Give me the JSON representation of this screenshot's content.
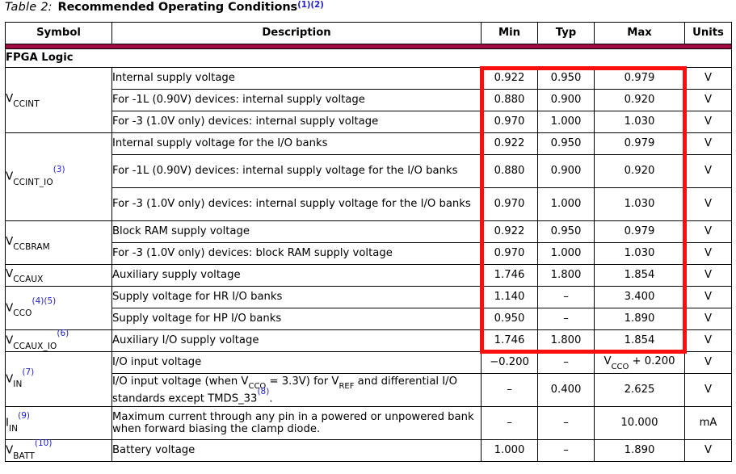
{
  "caption": {
    "label": "Table",
    "number": "2:",
    "title": "Recommended Operating Conditions",
    "footnotes": "(1)(2)"
  },
  "colors": {
    "header_rule": "#9e0b40",
    "footnote_blue": "#2222cc",
    "highlight_red": "#fb0f0f",
    "border": "#000000"
  },
  "table": {
    "columns": [
      "Symbol",
      "Description",
      "Min",
      "Typ",
      "Max",
      "Units"
    ],
    "section": "FPGA Logic",
    "rows": [
      {
        "symbol_main": "V",
        "symbol_sub": "CCINT",
        "symbol_fn": "",
        "description": "Internal supply voltage",
        "min": "0.922",
        "typ": "0.950",
        "max": "0.979",
        "units": "V",
        "lines": 1
      },
      {
        "symbol_main": "",
        "symbol_sub": "",
        "symbol_fn": "",
        "description": "For -1L (0.90V) devices: internal supply voltage",
        "min": "0.880",
        "typ": "0.900",
        "max": "0.920",
        "units": "V",
        "lines": 1
      },
      {
        "symbol_main": "",
        "symbol_sub": "",
        "symbol_fn": "",
        "description": "For -3 (1.0V only) devices: internal supply voltage",
        "min": "0.970",
        "typ": "1.000",
        "max": "1.030",
        "units": "V",
        "lines": 1
      },
      {
        "symbol_main": "V",
        "symbol_sub": "CCINT_IO",
        "symbol_fn": "(3)",
        "description": "Internal supply voltage for the I/O banks",
        "min": "0.922",
        "typ": "0.950",
        "max": "0.979",
        "units": "V",
        "lines": 1
      },
      {
        "symbol_main": "",
        "symbol_sub": "",
        "symbol_fn": "",
        "description": "For -1L (0.90V) devices: internal supply voltage for the I/O banks",
        "min": "0.880",
        "typ": "0.900",
        "max": "0.920",
        "units": "V",
        "lines": 2
      },
      {
        "symbol_main": "",
        "symbol_sub": "",
        "symbol_fn": "",
        "description": "For -3 (1.0V only) devices: internal supply voltage for the I/O banks",
        "min": "0.970",
        "typ": "1.000",
        "max": "1.030",
        "units": "V",
        "lines": 2
      },
      {
        "symbol_main": "V",
        "symbol_sub": "CCBRAM",
        "symbol_fn": "",
        "description": "Block RAM supply voltage",
        "min": "0.922",
        "typ": "0.950",
        "max": "0.979",
        "units": "V",
        "lines": 1
      },
      {
        "symbol_main": "",
        "symbol_sub": "",
        "symbol_fn": "",
        "description": "For -3 (1.0V only) devices: block RAM supply voltage",
        "min": "0.970",
        "typ": "1.000",
        "max": "1.030",
        "units": "V",
        "lines": 1
      },
      {
        "symbol_main": "V",
        "symbol_sub": "CCAUX",
        "symbol_fn": "",
        "description": "Auxiliary supply voltage",
        "min": "1.746",
        "typ": "1.800",
        "max": "1.854",
        "units": "V",
        "lines": 1
      },
      {
        "symbol_main": "V",
        "symbol_sub": "CCO",
        "symbol_fn": "(4)(5)",
        "description": "Supply voltage for HR I/O banks",
        "min": "1.140",
        "typ": "–",
        "max": "3.400",
        "units": "V",
        "lines": 1
      },
      {
        "symbol_main": "",
        "symbol_sub": "",
        "symbol_fn": "",
        "description": "Supply voltage for HP I/O banks",
        "min": "0.950",
        "typ": "–",
        "max": "1.890",
        "units": "V",
        "lines": 1
      },
      {
        "symbol_main": "V",
        "symbol_sub": "CCAUX_IO",
        "symbol_fn": "(6)",
        "description": "Auxiliary I/O supply voltage",
        "min": "1.746",
        "typ": "1.800",
        "max": "1.854",
        "units": "V",
        "lines": 1
      },
      {
        "symbol_main": "V",
        "symbol_sub": "IN",
        "symbol_fn": "(7)",
        "description": "I/O input voltage",
        "min": "−0.200",
        "typ": "–",
        "max": "V_CCO + 0.200",
        "units": "V",
        "lines": 1
      },
      {
        "symbol_main": "",
        "symbol_sub": "",
        "symbol_fn": "",
        "description": "I/O input voltage (when V_CCO = 3.3V) for V_REF and differential I/O standards except TMDS_33(8).",
        "min": "–",
        "typ": "0.400",
        "max": "2.625",
        "units": "V",
        "lines": 2
      },
      {
        "symbol_main": "I",
        "symbol_sub": "IN",
        "symbol_fn": "(9)",
        "description": "Maximum current through any pin in a powered or unpowered bank when forward biasing the clamp diode.",
        "min": "–",
        "typ": "–",
        "max": "10.000",
        "units": "mA",
        "lines": 2
      },
      {
        "symbol_main": "V",
        "symbol_sub": "BATT",
        "symbol_fn": "(10)",
        "description": "Battery voltage",
        "min": "1.000",
        "typ": "–",
        "max": "1.890",
        "units": "V",
        "lines": 1
      }
    ]
  },
  "annotation": {
    "highlight_label": "red-rectangle-highlight",
    "covers_columns": [
      "Min",
      "Typ",
      "Max"
    ],
    "covers_rows_from": "VCCINT internal supply voltage",
    "covers_rows_to": "VCCAUX_IO auxiliary I/O supply voltage"
  }
}
